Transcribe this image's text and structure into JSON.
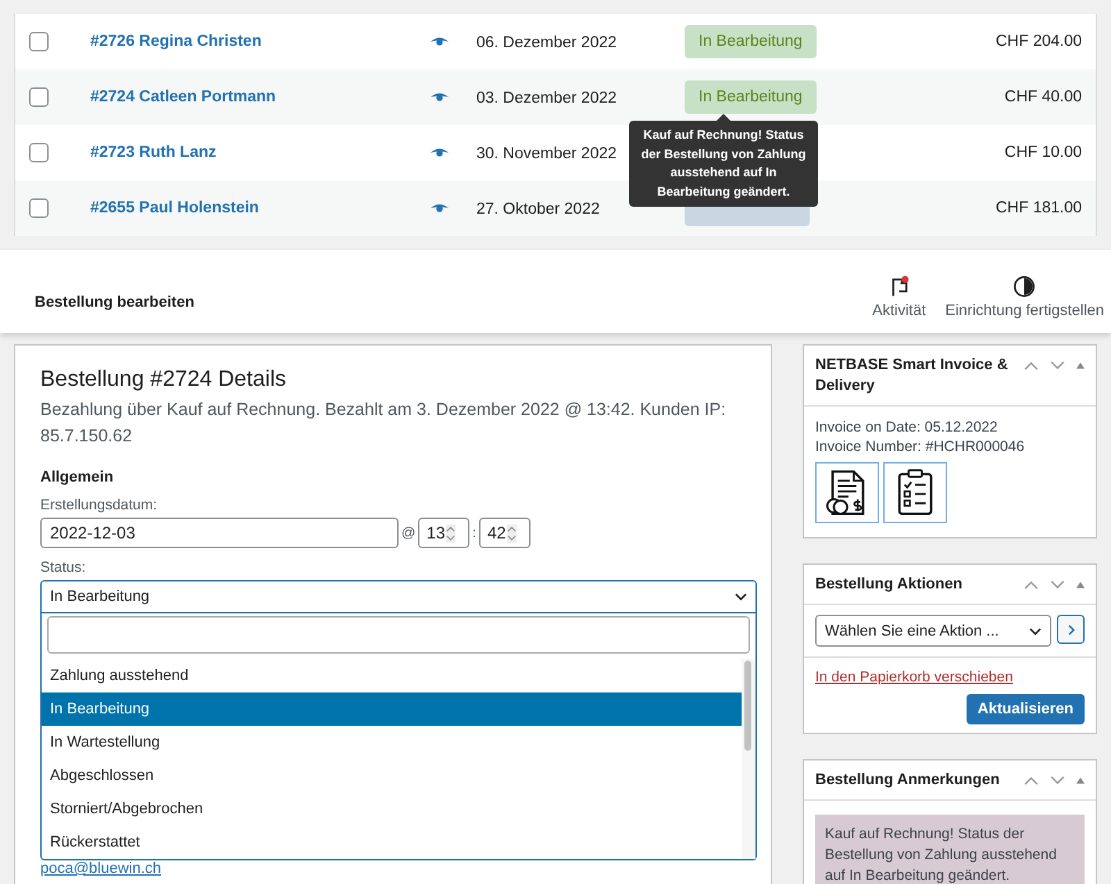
{
  "orders": [
    {
      "checked": false,
      "title": "#2726 Regina Christen",
      "date": "06. Dezember 2022",
      "status": "In Bearbeitung",
      "kind": "processing",
      "total": "CHF 204.00"
    },
    {
      "checked": false,
      "title": "#2724 Catleen Portmann",
      "date": "03. Dezember 2022",
      "status": "In Bearbeitung",
      "kind": "processing",
      "total": "CHF 40.00"
    },
    {
      "checked": false,
      "title": "#2723 Ruth Lanz",
      "date": "30. November 2022",
      "total": "CHF 10.00"
    },
    {
      "checked": false,
      "title": "#2655 Paul Holenstein",
      "date": "27. Oktober 2022",
      "kind": "completed",
      "total": "CHF 181.00"
    }
  ],
  "tooltip": {
    "text": "Kauf auf Rechnung! Status der Bestellung von Zahlung ausstehend auf In Bearbeitung geändert."
  },
  "header": {
    "title": "Bestellung bearbeiten",
    "actions": [
      {
        "label": "Aktivität"
      },
      {
        "label": "Einrichtung fertigstellen"
      }
    ]
  },
  "order": {
    "title": "Bestellung #2724 Details",
    "subtitle": "Bezahlung über Kauf auf Rechnung. Bezahlt am 3. Dezember 2022 @ 13:42. Kunden IP: 85.7.150.62",
    "section": "Allgemein",
    "date_label": "Erstellungsdatum:",
    "date": "2022-12-03",
    "at": "@",
    "hour": "13",
    "colon": ":",
    "minute": "42",
    "status_label": "Status:",
    "status_value": "In Bearbeitung",
    "status_options": [
      {
        "label": "Zahlung ausstehend",
        "selected": false
      },
      {
        "label": "In Bearbeitung",
        "selected": true
      },
      {
        "label": "In Wartestellung",
        "selected": false
      },
      {
        "label": "Abgeschlossen",
        "selected": false
      },
      {
        "label": "Storniert/Abgebrochen",
        "selected": false
      },
      {
        "label": "Rückerstattet",
        "selected": false
      }
    ],
    "email": "poca@bluewin.ch"
  },
  "invoice_box": {
    "title": "NETBASE Smart Invoice & Delivery",
    "lines": [
      "Invoice on Date: 05.12.2022",
      "Invoice Number: #HCHR000046"
    ]
  },
  "actions_box": {
    "title": "Bestellung Aktionen",
    "select": "Wählen Sie eine Aktion ...",
    "trash_link": "In den Papierkorb verschieben",
    "update_button": "Aktualisieren"
  },
  "notes_box": {
    "title": "Bestellung Anmerkungen",
    "notes": [
      "Kauf auf Rechnung! Status der Bestellung von Zahlung ausstehend auf In Bearbeitung geändert."
    ]
  }
}
